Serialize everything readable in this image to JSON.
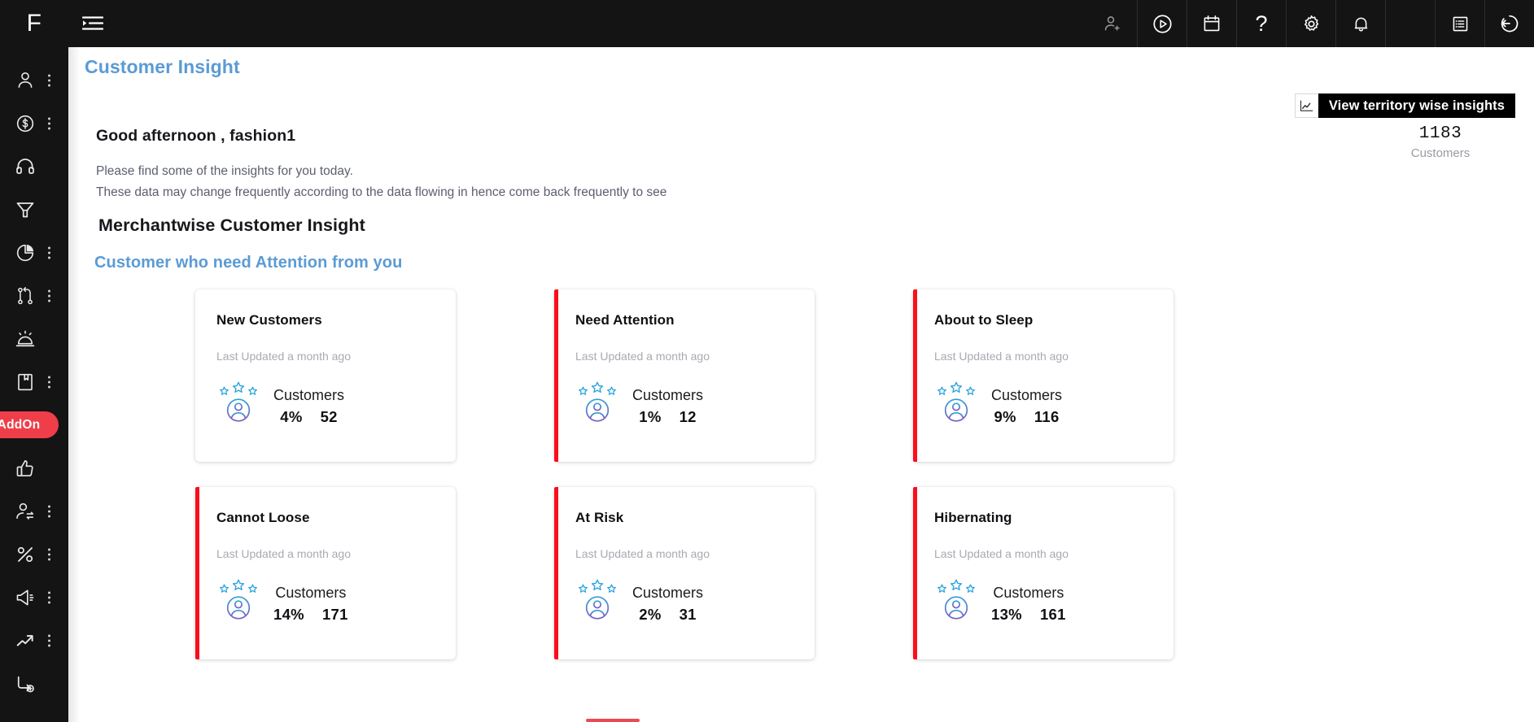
{
  "app": {
    "logo_letter": "F",
    "accent_blue": "#5b9bd5",
    "accent_red": "#fc0d1b",
    "addon_red": "#ef3e4a",
    "rail_bg": "#141414"
  },
  "rail": {
    "items": [
      {
        "icon": "user-icon",
        "name": "sidebar-item-user",
        "dots": true,
        "addon": false
      },
      {
        "icon": "dollar-circle-icon",
        "name": "sidebar-item-finance",
        "dots": true,
        "addon": false
      },
      {
        "icon": "headset-icon",
        "name": "sidebar-item-support",
        "dots": false,
        "addon": false
      },
      {
        "icon": "funnel-icon",
        "name": "sidebar-item-funnel",
        "dots": false,
        "addon": false
      },
      {
        "icon": "pie-chart-icon",
        "name": "sidebar-item-reports",
        "dots": true,
        "addon": false
      },
      {
        "icon": "git-branch-icon",
        "name": "sidebar-item-workflow",
        "dots": true,
        "addon": false
      },
      {
        "icon": "alarm-icon",
        "name": "sidebar-item-alerts",
        "dots": false,
        "addon": false
      },
      {
        "icon": "book-icon",
        "name": "sidebar-item-catalog",
        "dots": true,
        "addon": false
      },
      {
        "icon": "addon-pill",
        "name": "sidebar-item-addon",
        "dots": false,
        "addon": true,
        "label": "AddOn"
      },
      {
        "icon": "thumbs-up-icon",
        "name": "sidebar-item-feedback",
        "dots": false,
        "addon": false
      },
      {
        "icon": "user-switch-icon",
        "name": "sidebar-item-accounts",
        "dots": true,
        "addon": false
      },
      {
        "icon": "percent-icon",
        "name": "sidebar-item-discounts",
        "dots": true,
        "addon": false
      },
      {
        "icon": "megaphone-icon",
        "name": "sidebar-item-campaigns",
        "dots": true,
        "addon": false
      },
      {
        "icon": "trend-up-icon",
        "name": "sidebar-item-analytics",
        "dots": true,
        "addon": false
      },
      {
        "icon": "flow-add-icon",
        "name": "sidebar-item-add-flow",
        "dots": false,
        "addon": false
      }
    ]
  },
  "topbar": {
    "menu_toggle": "menu-toggle-icon",
    "actions": [
      {
        "icon": "add-user-icon",
        "name": "top-action-add-user",
        "dim": true
      },
      {
        "icon": "play-circle-icon",
        "name": "top-action-play",
        "dim": false
      },
      {
        "icon": "calendar-icon",
        "name": "top-action-calendar",
        "dim": false
      },
      {
        "icon": "help-icon",
        "name": "top-action-help",
        "dim": false,
        "glyph": "?"
      },
      {
        "icon": "gear-icon",
        "name": "top-action-settings",
        "dim": false
      },
      {
        "icon": "bell-icon",
        "name": "top-action-notifications",
        "dim": false
      },
      {
        "icon": "megaphone-icon",
        "name": "top-action-announcements",
        "dim": false
      },
      {
        "icon": "list-box-icon",
        "name": "top-action-tasks",
        "dim": false
      },
      {
        "icon": "logout-icon",
        "name": "top-action-logout",
        "dim": false
      }
    ]
  },
  "page": {
    "title": "Customer Insight",
    "territory_button": "View territory wise insights",
    "territory_icon": "line-chart-icon",
    "greeting": "Good afternoon , fashion1",
    "sub_line_1": "Please find some of the insights for you today.",
    "sub_line_2": "These data may change frequently according to the data flowing in hence come back frequently to see",
    "customer_total": {
      "count": "1183",
      "label": "Customers"
    },
    "section_title": "Merchantwise Customer Insight",
    "section_subtitle": "Customer who need Attention from you"
  },
  "cards": [
    {
      "title": "New Customers",
      "updated": "Last Updated a month ago",
      "stat_label": "Customers",
      "percent": "4%",
      "count": "52",
      "alert": false,
      "icon": "customer-rating-icon"
    },
    {
      "title": "Need Attention",
      "updated": "Last Updated a month ago",
      "stat_label": "Customers",
      "percent": "1%",
      "count": "12",
      "alert": true,
      "icon": "customer-rating-icon"
    },
    {
      "title": "About to Sleep",
      "updated": "Last Updated a month ago",
      "stat_label": "Customers",
      "percent": "9%",
      "count": "116",
      "alert": true,
      "icon": "customer-rating-icon"
    },
    {
      "title": "Cannot Loose",
      "updated": "Last Updated a month ago",
      "stat_label": "Customers",
      "percent": "14%",
      "count": "171",
      "alert": true,
      "icon": "customer-rating-icon"
    },
    {
      "title": "At Risk",
      "updated": "Last Updated a month ago",
      "stat_label": "Customers",
      "percent": "2%",
      "count": "31",
      "alert": true,
      "icon": "customer-rating-icon"
    },
    {
      "title": "Hibernating",
      "updated": "Last Updated a month ago",
      "stat_label": "Customers",
      "percent": "13%",
      "count": "161",
      "alert": true,
      "icon": "customer-rating-icon"
    }
  ]
}
